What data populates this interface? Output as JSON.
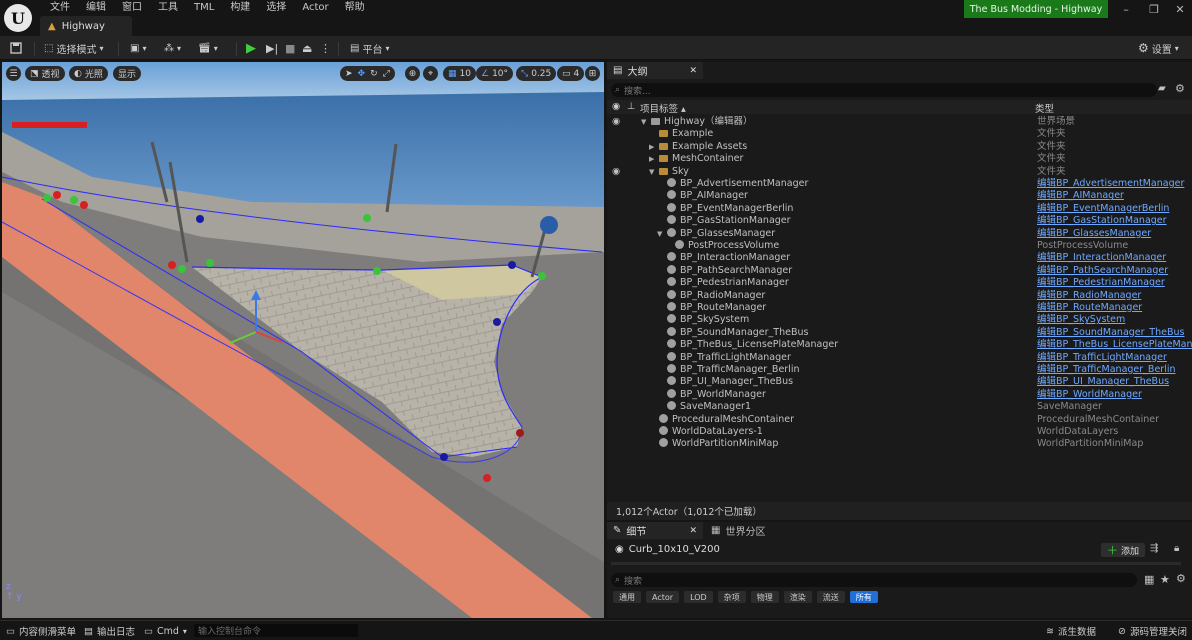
{
  "menu": [
    "文件",
    "编辑",
    "窗口",
    "工具",
    "TML",
    "构建",
    "选择",
    "Actor",
    "帮助"
  ],
  "document_tab": "Highway",
  "project_title": "The Bus Modding - Highway",
  "toolbar": {
    "select_mode": "选择模式",
    "platform": "平台",
    "settings": "设置"
  },
  "viewport": {
    "perspective": "透视",
    "lit": "光照",
    "show": "显示",
    "grid_snap": "10",
    "rotation_snap": "10°",
    "scale_snap": "0.25",
    "camera_speed": "4"
  },
  "outliner": {
    "tab": "大纲",
    "search_placeholder": "搜索...",
    "col_label": "项目标签",
    "col_type": "类型",
    "rows": [
      {
        "label": "Highway（编辑器）",
        "type": "世界场景",
        "indent": 0,
        "icon": "world",
        "style": "gray",
        "arrow": "down"
      },
      {
        "label": "Example",
        "type": "文件夹",
        "indent": 1,
        "icon": "folder",
        "style": "gray",
        "arrow": ""
      },
      {
        "label": "Example Assets",
        "type": "文件夹",
        "indent": 1,
        "icon": "folder",
        "style": "gray",
        "arrow": "right"
      },
      {
        "label": "MeshContainer",
        "type": "文件夹",
        "indent": 1,
        "icon": "folder",
        "style": "gray",
        "arrow": "right"
      },
      {
        "label": "Sky",
        "type": "文件夹",
        "indent": 1,
        "icon": "folder",
        "style": "gray",
        "arrow": "down"
      },
      {
        "label": "BP_AdvertisementManager",
        "type": "编辑BP_AdvertisementManager",
        "indent": 2,
        "icon": "ball",
        "style": "link",
        "arrow": ""
      },
      {
        "label": "BP_AIManager",
        "type": "编辑BP_AIManager",
        "indent": 2,
        "icon": "ball",
        "style": "link",
        "arrow": ""
      },
      {
        "label": "BP_EventManagerBerlin",
        "type": "编辑BP_EventManagerBerlin",
        "indent": 2,
        "icon": "ball",
        "style": "link",
        "arrow": ""
      },
      {
        "label": "BP_GasStationManager",
        "type": "编辑BP_GasStationManager",
        "indent": 2,
        "icon": "ball",
        "style": "link",
        "arrow": ""
      },
      {
        "label": "BP_GlassesManager",
        "type": "编辑BP_GlassesManager",
        "indent": 2,
        "icon": "ball",
        "style": "link",
        "arrow": "down"
      },
      {
        "label": "PostProcessVolume",
        "type": "PostProcessVolume",
        "indent": 3,
        "icon": "ball",
        "style": "gray",
        "arrow": ""
      },
      {
        "label": "BP_InteractionManager",
        "type": "编辑BP_InteractionManager",
        "indent": 2,
        "icon": "ball",
        "style": "link",
        "arrow": ""
      },
      {
        "label": "BP_PathSearchManager",
        "type": "编辑BP_PathSearchManager",
        "indent": 2,
        "icon": "ball",
        "style": "link",
        "arrow": ""
      },
      {
        "label": "BP_PedestrianManager",
        "type": "编辑BP_PedestrianManager",
        "indent": 2,
        "icon": "ball",
        "style": "link",
        "arrow": ""
      },
      {
        "label": "BP_RadioManager",
        "type": "编辑BP_RadioManager",
        "indent": 2,
        "icon": "ball",
        "style": "link",
        "arrow": ""
      },
      {
        "label": "BP_RouteManager",
        "type": "编辑BP_RouteManager",
        "indent": 2,
        "icon": "ball",
        "style": "link",
        "arrow": ""
      },
      {
        "label": "BP_SkySystem",
        "type": "编辑BP_SkySystem",
        "indent": 2,
        "icon": "ball",
        "style": "link",
        "arrow": ""
      },
      {
        "label": "BP_SoundManager_TheBus",
        "type": "编辑BP_SoundManager_TheBus",
        "indent": 2,
        "icon": "ball",
        "style": "link",
        "arrow": ""
      },
      {
        "label": "BP_TheBus_LicensePlateManager",
        "type": "编辑BP_TheBus_LicensePlateManager",
        "indent": 2,
        "icon": "ball",
        "style": "link",
        "arrow": ""
      },
      {
        "label": "BP_TrafficLightManager",
        "type": "编辑BP_TrafficLightManager",
        "indent": 2,
        "icon": "ball",
        "style": "link",
        "arrow": ""
      },
      {
        "label": "BP_TrafficManager_Berlin",
        "type": "编辑BP_TrafficManager_Berlin",
        "indent": 2,
        "icon": "ball",
        "style": "link",
        "arrow": ""
      },
      {
        "label": "BP_UI_Manager_TheBus",
        "type": "编辑BP_UI_Manager_TheBus",
        "indent": 2,
        "icon": "ball",
        "style": "link",
        "arrow": ""
      },
      {
        "label": "BP_WorldManager",
        "type": "编辑BP_WorldManager",
        "indent": 2,
        "icon": "ball",
        "style": "link",
        "arrow": ""
      },
      {
        "label": "SaveManager1",
        "type": "SaveManager",
        "indent": 2,
        "icon": "ball",
        "style": "gray",
        "arrow": ""
      },
      {
        "label": "ProceduralMeshContainer",
        "type": "ProceduralMeshContainer",
        "indent": 1,
        "icon": "ball",
        "style": "gray",
        "arrow": ""
      },
      {
        "label": "WorldDataLayers-1",
        "type": "WorldDataLayers",
        "indent": 1,
        "icon": "ball",
        "style": "gray",
        "arrow": ""
      },
      {
        "label": "WorldPartitionMiniMap",
        "type": "WorldPartitionMiniMap",
        "indent": 1,
        "icon": "ball",
        "style": "gray",
        "arrow": ""
      }
    ],
    "status": "1,012个Actor（1,012个已加载）"
  },
  "details": {
    "tab": "细节",
    "tab2": "世界分区",
    "actor_name": "Curb_10x10_V200",
    "add_label": "添加",
    "search_placeholder": "搜索",
    "filters": [
      "通用",
      "Actor",
      "LOD",
      "杂项",
      "物理",
      "渲染",
      "流送",
      "所有"
    ],
    "active_filter": "所有"
  },
  "statusbar": {
    "content_drawer": "内容侧滑菜单",
    "output_log": "输出日志",
    "cmd": "Cmd",
    "console_placeholder": "输入控制台命令",
    "derived_data": "派生数据",
    "source_control": "源码管理关闭"
  },
  "colors": {
    "project_badge": "#1a7a1a",
    "link": "#6fa8ff",
    "active_filter": "#1f6fd6",
    "bike_lane": "#e8876a"
  }
}
